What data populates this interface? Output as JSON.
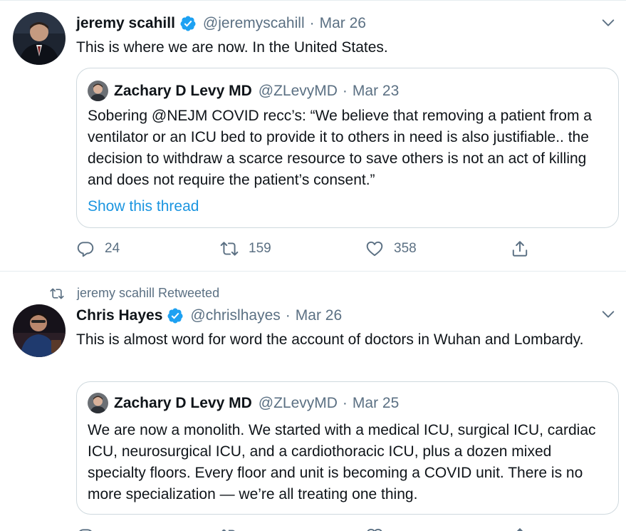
{
  "tweet1": {
    "author_name": "jeremy scahill",
    "handle": "@jeremyscahill",
    "separator": "·",
    "date": "Mar 26",
    "text": "This is where we are now. In the United States.",
    "quote": {
      "author_name": "Zachary D Levy MD",
      "handle": "@ZLevyMD",
      "separator": "·",
      "date": "Mar 23",
      "text": "Sobering @NEJM COVID recc’s: “We believe that removing a patient from a ventilator or an ICU bed to provide it to others in need is also justifiable.. the decision to withdraw a scarce resource to save others is not an act of killing and does not require the patient’s consent.”",
      "show_thread": "Show this thread"
    },
    "replies": "24",
    "retweets": "159",
    "likes": "358"
  },
  "tweet2": {
    "retweeted_by": "jeremy scahill Retweeted",
    "author_name": "Chris Hayes",
    "handle": "@chrislhayes",
    "separator": "·",
    "date": "Mar 26",
    "text": "This is almost word for word the account of doctors in Wuhan and Lombardy.",
    "quote": {
      "author_name": "Zachary D Levy MD",
      "handle": "@ZLevyMD",
      "separator": "·",
      "date": "Mar 25",
      "text": "We are now a monolith.  We started with a medical ICU, surgical ICU, cardiac ICU, neurosurgical ICU, and a cardiothoracic ICU, plus a dozen mixed specialty floors.  Every floor and unit is becoming a COVID unit.  There is no more specialization — we’re all treating one thing."
    }
  },
  "icons": {
    "verified": "verified-badge-icon",
    "caret": "chevron-down-icon",
    "reply": "reply-icon",
    "retweet": "retweet-icon",
    "like": "heart-icon",
    "share": "share-icon"
  },
  "colors": {
    "link": "#1b95e0",
    "verified": "#1da1f2",
    "secondary_text": "#5b7083",
    "border": "#cfd9de"
  }
}
